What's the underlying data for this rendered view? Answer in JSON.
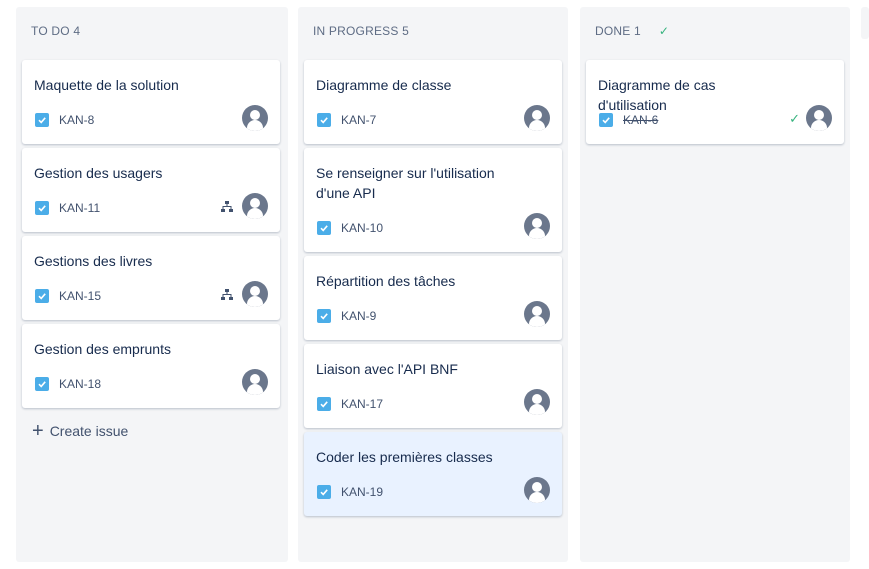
{
  "columns": {
    "todo": {
      "title": "TO DO 4",
      "create_label": "Create issue",
      "cards": [
        {
          "title": "Maquette de la solution",
          "key": "KAN-8"
        },
        {
          "title": "Gestion des usagers",
          "key": "KAN-11"
        },
        {
          "title": "Gestions des livres",
          "key": "KAN-15"
        },
        {
          "title": "Gestion des emprunts",
          "key": "KAN-18"
        }
      ]
    },
    "progress": {
      "title": "IN PROGRESS 5",
      "cards": [
        {
          "title": "Diagramme de classe",
          "key": "KAN-7"
        },
        {
          "title": "Se renseigner sur l'utilisation d'une API",
          "key": "KAN-10"
        },
        {
          "title": "Répartition des tâches",
          "key": "KAN-9"
        },
        {
          "title": "Liaison avec l'API BNF",
          "key": "KAN-17"
        },
        {
          "title": "Coder les premières classes",
          "key": "KAN-19"
        }
      ]
    },
    "done": {
      "title": "DONE 1",
      "cards": [
        {
          "title": "Diagramme de cas d'utilisation",
          "key": "KAN-6"
        }
      ]
    }
  },
  "colors": {
    "task_icon": "#4bade8",
    "done_check": "#36b37e",
    "selected_card": "#e9f2ff"
  }
}
